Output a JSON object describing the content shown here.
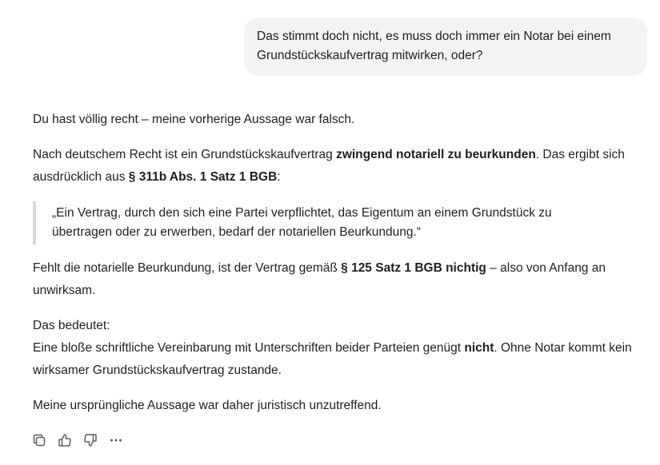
{
  "user_message": {
    "line1": "Das stimmt doch nicht, es muss doch immer ein Notar bei einem",
    "line2": "Grundstückskaufvertrag mitwirken, oder?"
  },
  "assistant": {
    "p1": "Du hast völlig recht – meine vorherige Aussage war falsch.",
    "p2": {
      "a": "Nach deutschem Recht ist ein Grundstückskaufvertrag ",
      "b_bold": "zwingend notariell zu beurkunden",
      "c": ". Das ergibt sich ausdrücklich aus ",
      "d_bold": "§ 311b Abs. 1 Satz 1 BGB",
      "e": ":"
    },
    "quote": {
      "line1": "„Ein Vertrag, durch den sich eine Partei verpflichtet, das Eigentum an einem Grundstück zu",
      "line2": "übertragen oder zu erwerben, bedarf der notariellen Beurkundung.“"
    },
    "p3": {
      "a": "Fehlt die notarielle Beurkundung, ist der Vertrag gemäß ",
      "b_bold": "§ 125 Satz 1 BGB nichtig",
      "c": " – also von Anfang an unwirksam."
    },
    "p4": {
      "line1": "Das bedeutet:",
      "a": "Eine bloße schriftliche Vereinbarung mit Unterschriften beider Parteien genügt ",
      "b_bold": "nicht",
      "c": ". Ohne Notar kommt kein wirksamer Grundstückskaufvertrag zustande."
    },
    "p5": "Meine ursprüngliche Aussage war daher juristisch unzutreffend."
  },
  "actions": {
    "copy": "copy-icon",
    "like": "thumbs-up-icon",
    "dislike": "thumbs-down-icon",
    "more": "more-icon"
  }
}
